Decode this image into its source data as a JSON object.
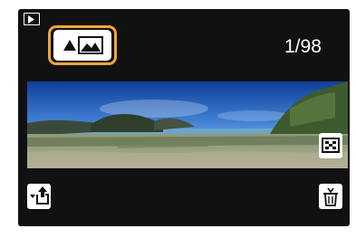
{
  "screen": {
    "mode_icon": "playback-icon",
    "playback_counter": "1/98",
    "panorama_play_button": {
      "icon": "panorama-play-icon",
      "state": "selected",
      "highlight_color": "#f2a43a"
    },
    "panorama_image": {
      "description_icon": "panorama-landscape-image"
    },
    "buttons": {
      "display_toggle": {
        "icon": "display-toggle-icon"
      },
      "return": {
        "icon": "return-icon"
      },
      "delete": {
        "icon": "trash-icon"
      }
    }
  }
}
